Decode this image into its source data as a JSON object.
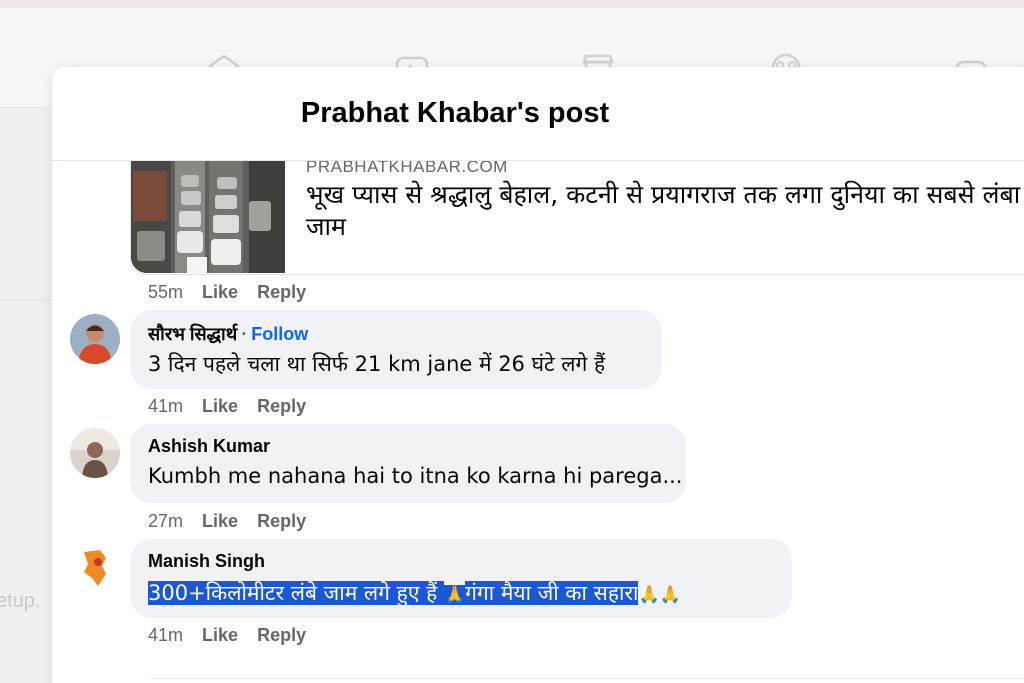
{
  "nav_icons": [
    "home-icon",
    "video-icon",
    "marketplace-icon",
    "groups-icon",
    "gaming-icon"
  ],
  "background": {
    "side_text": "etup."
  },
  "modal": {
    "title": "Prabhat Khabar's post"
  },
  "link_preview": {
    "domain": "PRABHATKHABAR.COM",
    "title": "भूख प्यास से श्रद्धालु बेहाल, कटनी से प्रयागराज तक लगा दुनिया का सबसे लंबा जाम",
    "meta": {
      "time": "55m",
      "like": "Like",
      "reply": "Reply"
    }
  },
  "comments": [
    {
      "author": "सौरभ सिद्धार्थ",
      "follow_separator": "·",
      "follow": "Follow",
      "text": "3 दिन पहले चला था सिर्फ 21 km jane में 26 घंटे लगे हैं",
      "time": "41m",
      "like": "Like",
      "reply": "Reply"
    },
    {
      "author": "Ashish Kumar",
      "text": "Kumbh me nahana hai to itna ko karna hi parega...",
      "time": "27m",
      "like": "Like",
      "reply": "Reply"
    },
    {
      "author": "Manish Singh",
      "text_part1": "300+किलोमीटर लंबे जाम लगे हुए हैं ",
      "text_emoji1": "🙏",
      "text_part2": "गंगा मैया जी का सहारा",
      "text_emoji2": "🙏🙏",
      "time": "41m",
      "like": "Like",
      "reply": "Reply"
    }
  ],
  "colors": {
    "link_blue": "#0866ff",
    "selection": "#1d58d3",
    "bubble": "#f0f2f5",
    "secondary_text": "#65676b"
  }
}
